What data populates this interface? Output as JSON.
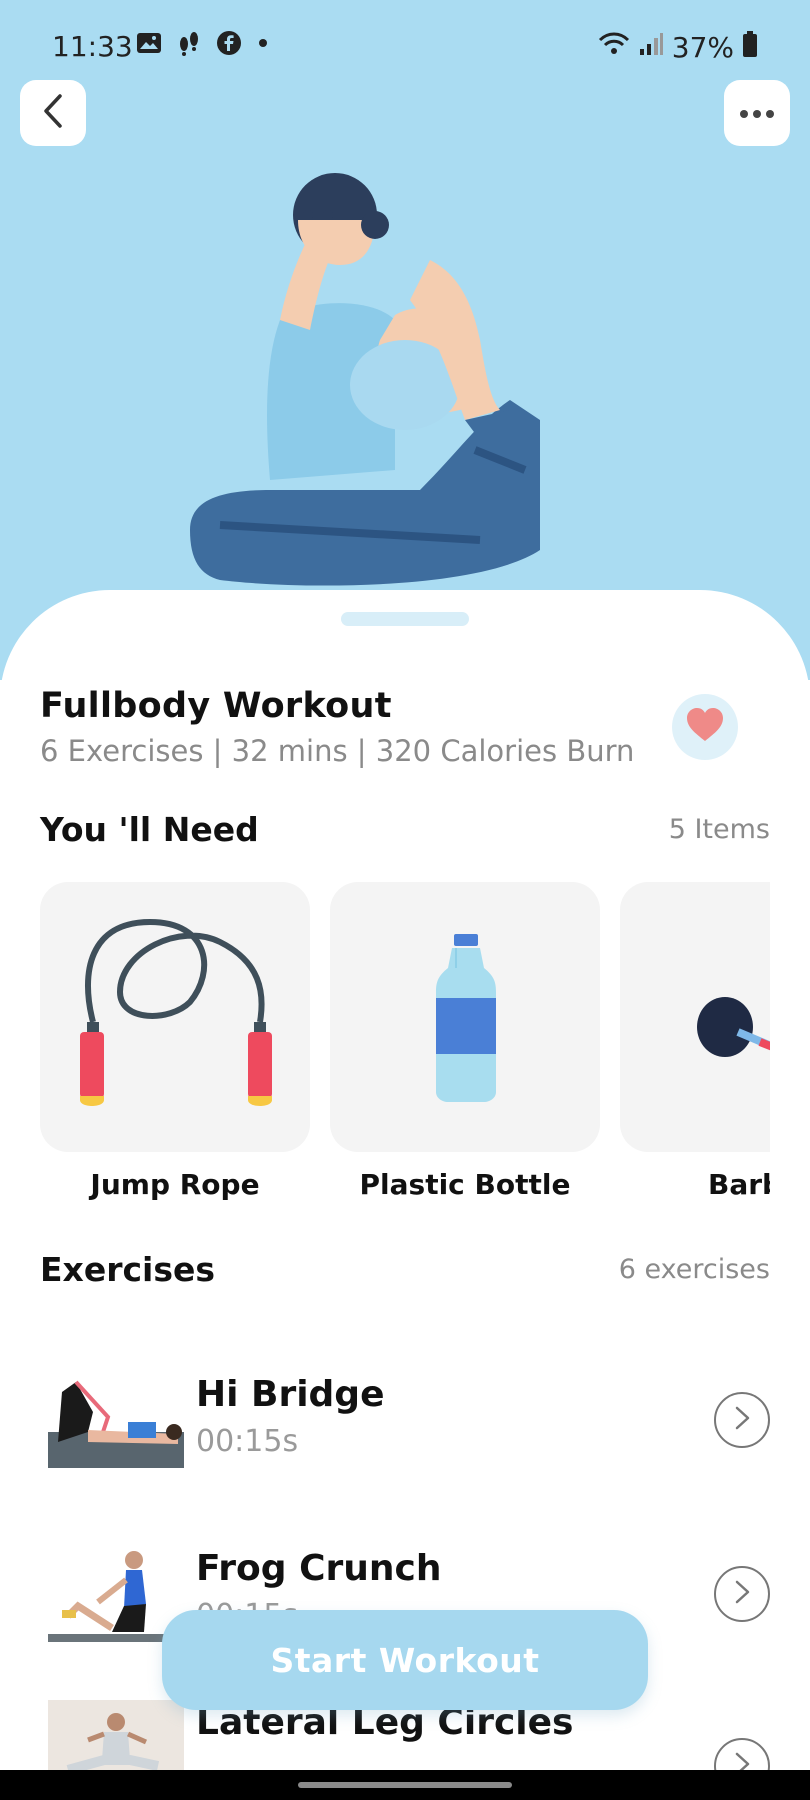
{
  "status_bar": {
    "time": "11:33",
    "battery": "37%",
    "icons": [
      "gallery-icon",
      "footsteps-icon",
      "facebook-icon",
      "dot-icon",
      "wifi-icon",
      "signal-icon",
      "battery-icon"
    ]
  },
  "nav": {
    "back_icon": "chevron-left-icon",
    "more_icon": "more-horizontal-icon"
  },
  "workout": {
    "title": "Fullbody Workout",
    "subtitle": "6 Exercises | 32 mins | 320 Calories Burn",
    "favorite_icon": "heart-icon"
  },
  "needs": {
    "title": "You 'll Need",
    "count": "5 Items",
    "items": [
      {
        "label": "Jump Rope",
        "icon": "jump-rope-icon"
      },
      {
        "label": "Plastic Bottle",
        "icon": "plastic-bottle-icon"
      },
      {
        "label": "Barb",
        "icon": "barbell-icon"
      }
    ]
  },
  "exercises": {
    "title": "Exercises",
    "count": "6 exercises",
    "list": [
      {
        "name": "Hi Bridge",
        "time": "00:15s"
      },
      {
        "name": "Frog Crunch",
        "time": "00:15s"
      },
      {
        "name": "Lateral Leg Circles",
        "time": ""
      }
    ]
  },
  "start_button": "Start Workout",
  "colors": {
    "hero_bg": "#aadcf2",
    "accent": "#a6d8ef",
    "heart": "#ef8a88",
    "muted_text": "#8a8a8a"
  }
}
